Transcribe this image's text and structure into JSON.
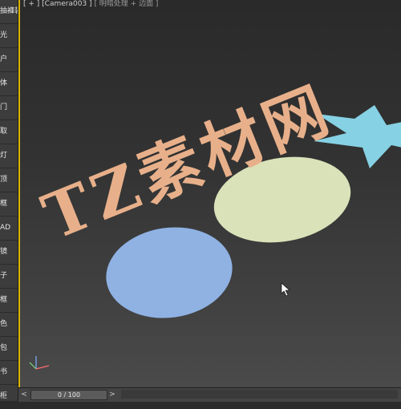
{
  "sidebar": {
    "items": [
      "抽褲装",
      "光",
      "户",
      "体",
      "门",
      "取",
      "灯",
      "顶",
      "框",
      "AD",
      "镜",
      "子",
      "框",
      "色",
      "包",
      "书",
      "柜"
    ]
  },
  "viewport": {
    "label_bracket": "[ + ]",
    "label_camera": "[Camera003 ]",
    "label_mode": "[ 明暗处理 + 边面 ]",
    "scene_text": "TZ素材网"
  },
  "shapes": {
    "text_color": "#e8b08a",
    "star_color": "#86d1e3",
    "ellipse_large_color": "#d9e2b9",
    "ellipse_small_color": "#8fb2e3"
  },
  "timeline": {
    "frame_display": "0 / 100",
    "prev_label": "<",
    "next_label": ">"
  }
}
